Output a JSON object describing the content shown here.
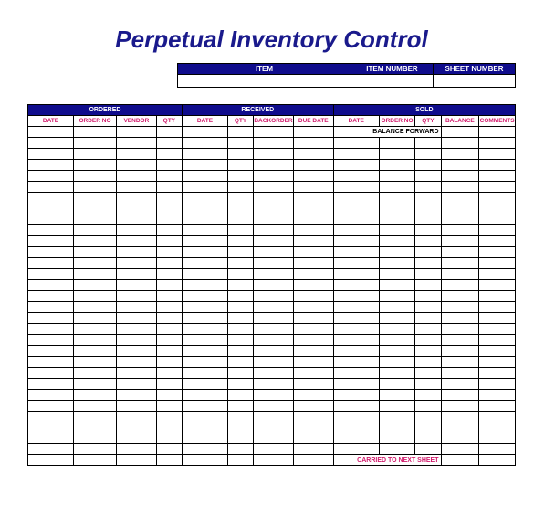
{
  "title": "Perpetual Inventory Control",
  "header": {
    "item_label": "ITEM",
    "item_number_label": "ITEM NUMBER",
    "sheet_number_label": "SHEET NUMBER"
  },
  "sections": {
    "ordered": "ORDERED",
    "received": "RECEIVED",
    "sold": "SOLD"
  },
  "columns": {
    "ordered_date": "DATE",
    "ordered_order_no": "ORDER NO",
    "ordered_vendor": "VENDOR",
    "ordered_qty": "QTY",
    "received_date": "DATE",
    "received_qty": "QTY",
    "received_backorder": "BACKORDER",
    "received_due_date": "DUE DATE",
    "sold_date": "DATE",
    "sold_order_no": "ORDER NO",
    "sold_qty": "QTY",
    "sold_balance": "BALANCE",
    "sold_comments": "COMMENTS"
  },
  "labels": {
    "balance_forward": "BALANCE FORWARD",
    "carried_next": "CARRIED TO NEXT SHEET"
  },
  "data_rows": 29
}
